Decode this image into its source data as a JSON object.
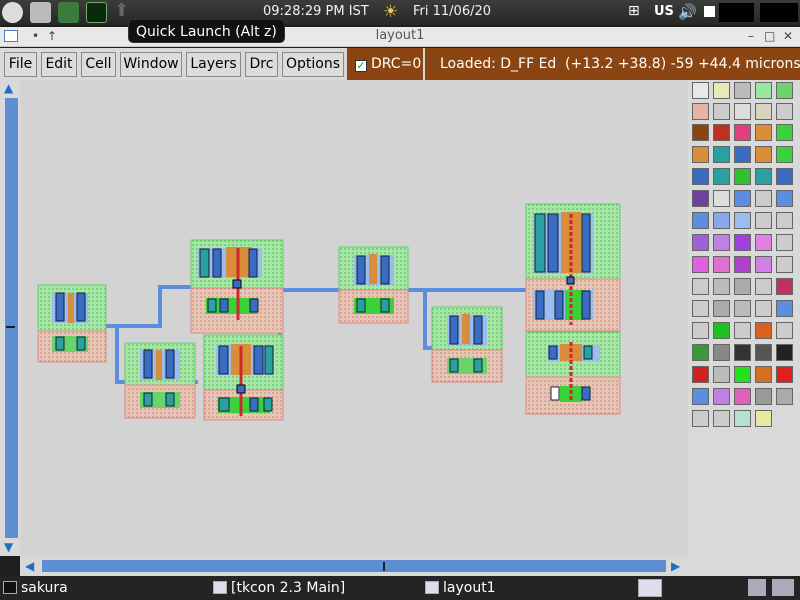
{
  "top_panel": {
    "clock": "09:28:29 PM IST",
    "date": "Fri 11/06/20",
    "keyboard_layout": "US",
    "tooltip": "Quick Launch (Alt z)"
  },
  "window": {
    "title": "layout1"
  },
  "menu": {
    "items": [
      "File",
      "Edit",
      "Cell",
      "Window",
      "Layers",
      "Drc",
      "Options"
    ]
  },
  "drc": {
    "label": "DRC=0",
    "checked": true
  },
  "status": {
    "loaded": "Loaded: D_FF Ed",
    "coords": "(+13.2 +38.8) -59 +44.4 microns"
  },
  "taskbar": {
    "items": [
      "sakura",
      "[tkcon 2.3 Main]",
      "layout1"
    ]
  },
  "colors": {
    "status_bg": "#8b4513",
    "scroll_accent": "#5d8fd0",
    "canvas_bg": "#d3d3d3",
    "metal1": "#5b8de0",
    "poly": "#cc2a2a",
    "nwell": "#90e090",
    "pwell": "#e4b4a4"
  }
}
